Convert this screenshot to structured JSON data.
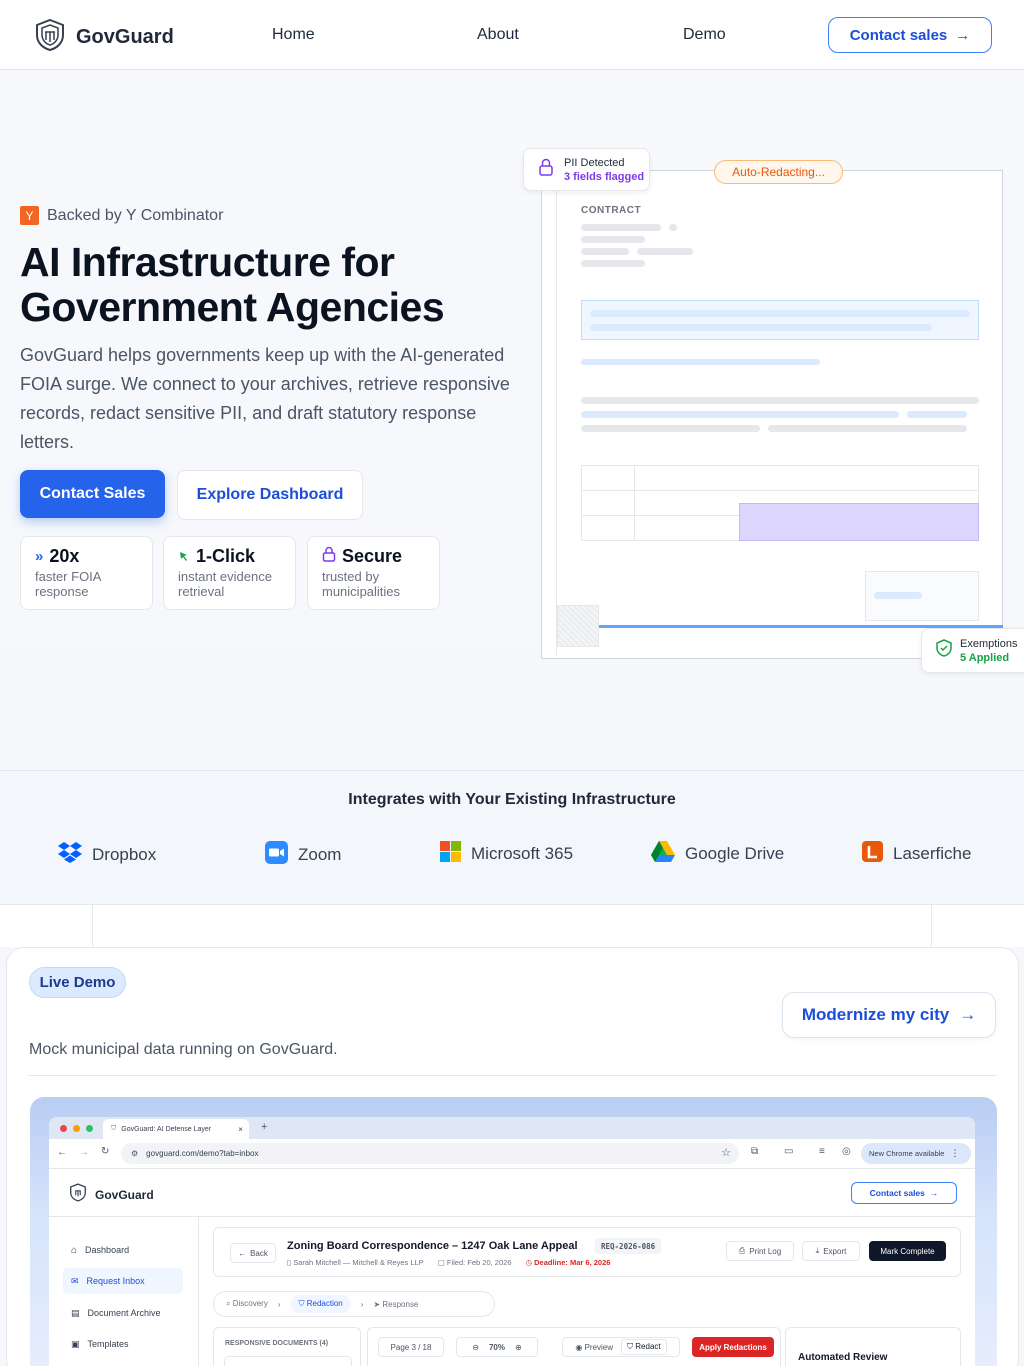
{
  "header": {
    "brand": "GovGuard",
    "nav": [
      "Home",
      "About",
      "Demo"
    ],
    "cta": "Contact sales"
  },
  "hero": {
    "badge": "Backed by Y Combinator",
    "badge_logo": "Y",
    "title_line1": "AI Infrastructure for",
    "title_line2": "Government Agencies",
    "subtitle": "GovGuard helps governments keep up with the AI-generated FOIA surge. We connect to your archives, retrieve responsive records, redact sensitive PII, and draft statutory response letters.",
    "primary_button": "Contact Sales",
    "secondary_button": "Explore Dashboard",
    "stats": [
      {
        "icon": "double-chevron-icon",
        "value": "20x",
        "desc": "faster FOIA response"
      },
      {
        "icon": "cursor-click-icon",
        "value": "1-Click",
        "desc": "instant evidence retrieval"
      },
      {
        "icon": "lock-icon",
        "value": "Secure",
        "desc": "trusted by municipalities"
      }
    ]
  },
  "doc_mock": {
    "label": "CONTRACT",
    "pii_title": "PII Detected",
    "pii_sub": "3 fields flagged",
    "auto": "Auto-Redacting...",
    "ex_title": "Exemptions",
    "ex_sub": "5 Applied",
    "colors": {
      "pii": "#7c3aed",
      "auto": "#ea580c",
      "ex": "#16a34a"
    }
  },
  "integrations": {
    "title": "Integrates with Your Existing Infrastructure",
    "items": [
      "Dropbox",
      "Zoom",
      "Microsoft 365",
      "Google Drive",
      "Laserfiche"
    ]
  },
  "demo": {
    "pill": "Live Demo",
    "subtitle": "Mock municipal data running on GovGuard.",
    "cta": "Modernize my city",
    "browser": {
      "tab_title": "GovGuard: AI Defense Layer",
      "url": "govguard.com/demo?tab=inbox",
      "chrome_badge": "New Chrome available",
      "app_brand": "GovGuard",
      "app_cta": "Contact sales",
      "sidebar": [
        "Dashboard",
        "Request Inbox",
        "Document Archive",
        "Templates"
      ],
      "back": "Back",
      "case_title": "Zoning Board Correspondence – 1247 Oak Lane Appeal",
      "case_id": "REQ-2026-086",
      "requester": "Sarah Mitchell — Mitchell & Reyes LLP",
      "filed": "Filed: Feb 20, 2026",
      "deadline": "Deadline: Mar 6, 2026",
      "print": "Print Log",
      "export": "Export",
      "complete": "Mark Complete",
      "steps": [
        "Discovery",
        "Redaction",
        "Response"
      ],
      "docs_header": "RESPONSIVE DOCUMENTS (4)",
      "page": "Page 3 / 18",
      "zoom": "70%",
      "preview": "Preview",
      "redact": "Redact",
      "apply": "Apply Redactions",
      "review": "Automated Review"
    }
  }
}
